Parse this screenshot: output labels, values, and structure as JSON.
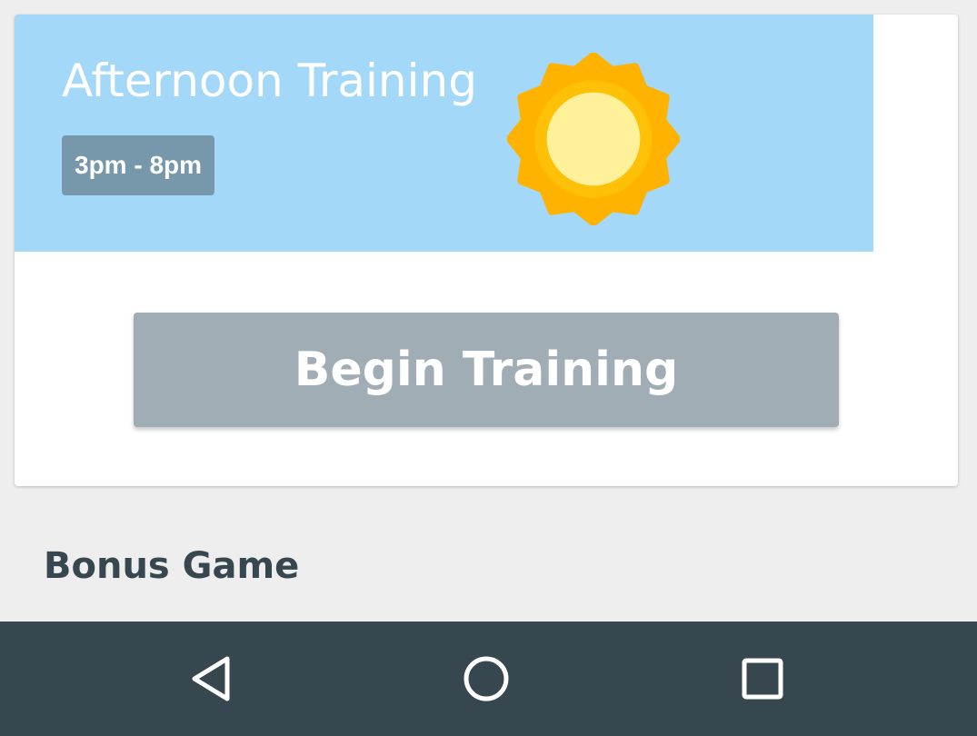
{
  "card": {
    "title": "Afternoon Training",
    "time_range": "3pm - 8pm",
    "banner_color": "#a3d8f8",
    "begin_label": "Begin Training",
    "icon": "sun-icon"
  },
  "sections": {
    "bonus_title": "Bonus Game"
  },
  "navigation": {
    "back_icon": "back-triangle-icon",
    "home_icon": "home-circle-icon",
    "recents_icon": "recents-square-icon",
    "bar_color": "#37474f"
  }
}
